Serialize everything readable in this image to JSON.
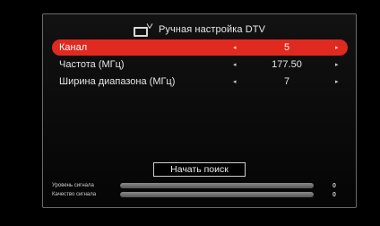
{
  "header": {
    "icon": "tv-icon",
    "title": "Ручная настройка DTV"
  },
  "settings": [
    {
      "label": "Канал",
      "value": "5",
      "selected": true
    },
    {
      "label": "Частота (МГц)",
      "value": "177.50",
      "selected": false
    },
    {
      "label": "Ширина диапазона (МГц)",
      "value": "7",
      "selected": false
    }
  ],
  "arrows": {
    "left": "◂",
    "right": "▸"
  },
  "search_button": "Начать поиск",
  "signal": {
    "strength": {
      "label": "Уровень сигнала",
      "value": "0",
      "level": 0
    },
    "quality": {
      "label": "Качество сигнала",
      "value": "0",
      "level": 0
    }
  },
  "colors": {
    "selected_row": "#e0291f",
    "background": "#000000"
  }
}
